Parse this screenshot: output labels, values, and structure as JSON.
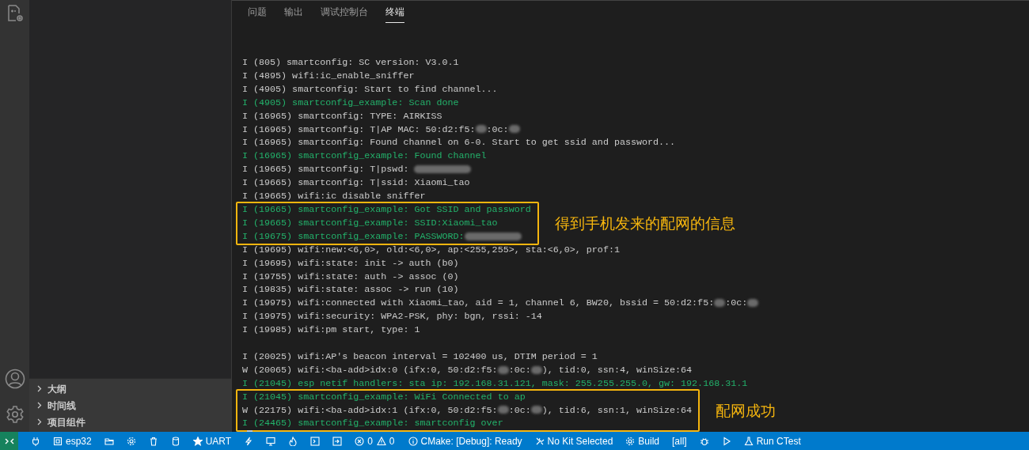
{
  "sidebar": {
    "sections": [
      {
        "label": "大纲",
        "expanded": false
      },
      {
        "label": "时间线",
        "expanded": false
      },
      {
        "label": "项目组件",
        "expanded": false
      }
    ]
  },
  "panel": {
    "tabs": [
      {
        "label": "问题",
        "selected": false
      },
      {
        "label": "输出",
        "selected": false
      },
      {
        "label": "调试控制台",
        "selected": false
      },
      {
        "label": "终端",
        "selected": true
      }
    ],
    "blocks": [
      {
        "lines": [
          {
            "green": false,
            "segments": [
              "I (805) smartconfig: SC version: V3.0.1"
            ]
          },
          {
            "green": false,
            "segments": [
              "I (4895) wifi:ic_enable_sniffer"
            ]
          },
          {
            "green": false,
            "segments": [
              "I (4905) smartconfig: Start to find channel..."
            ]
          },
          {
            "green": true,
            "segments": [
              "I (4905) smartconfig_example: Scan done"
            ]
          },
          {
            "green": false,
            "segments": [
              "I (16965) smartconfig: TYPE: AIRKISS"
            ]
          },
          {
            "green": false,
            "segments": [
              "I (16965) smartconfig: T|AP MAC: 50:d2:f5:",
              {
                "kind": "blur"
              },
              ":0c:",
              {
                "kind": "blur"
              }
            ]
          },
          {
            "green": false,
            "segments": [
              "I (16965) smartconfig: Found channel on 6-0. Start to get ssid and password..."
            ]
          },
          {
            "green": true,
            "segments": [
              "I (16965) smartconfig_example: Found channel"
            ]
          },
          {
            "green": false,
            "segments": [
              "I (19665) smartconfig: T|pswd: ",
              {
                "kind": "mask"
              }
            ]
          },
          {
            "green": false,
            "segments": [
              "I (19665) smartconfig: T|ssid: Xiaomi_tao"
            ]
          },
          {
            "green": false,
            "segments": [
              "I (19665) wifi:ic disable sniffer"
            ]
          }
        ]
      },
      {
        "annotation": "得到手机发来的配网的信息",
        "lines": [
          {
            "green": true,
            "segments": [
              "I (19665) smartconfig_example: Got SSID and password"
            ]
          },
          {
            "green": true,
            "segments": [
              "I (19665) smartconfig_example: SSID:Xiaomi_tao"
            ]
          },
          {
            "green": true,
            "segments": [
              "I (19675) smartconfig_example: PASSWORD:",
              {
                "kind": "mask"
              }
            ]
          }
        ]
      },
      {
        "lines": [
          {
            "green": false,
            "segments": [
              "I (19695) wifi:new:<6,0>, old:<6,0>, ap:<255,255>, sta:<6,0>, prof:1"
            ]
          },
          {
            "green": false,
            "segments": [
              "I (19695) wifi:state: init -> auth (b0)"
            ]
          },
          {
            "green": false,
            "segments": [
              "I (19755) wifi:state: auth -> assoc (0)"
            ]
          },
          {
            "green": false,
            "segments": [
              "I (19835) wifi:state: assoc -> run (10)"
            ]
          },
          {
            "green": false,
            "segments": [
              "I (19975) wifi:connected with Xiaomi_tao, aid = 1, channel 6, BW20, bssid = 50:d2:f5:",
              {
                "kind": "blur"
              },
              ":0c:",
              {
                "kind": "blur"
              }
            ]
          },
          {
            "green": false,
            "segments": [
              "I (19975) wifi:security: WPA2-PSK, phy: bgn, rssi: -14"
            ]
          },
          {
            "green": false,
            "segments": [
              "I (19985) wifi:pm start, type: 1"
            ]
          },
          {
            "kind": "blank"
          },
          {
            "green": false,
            "segments": [
              "I (20025) wifi:AP's beacon interval = 102400 us, DTIM period = 1"
            ]
          },
          {
            "green": false,
            "segments": [
              "W (20065) wifi:<ba-add>idx:0 (ifx:0, 50:d2:f5:",
              {
                "kind": "blur"
              },
              ":0c:",
              {
                "kind": "blur"
              },
              "), tid:0, ssn:4, winSize:64"
            ]
          },
          {
            "green": true,
            "segments": [
              "I (21045) esp netif handlers: sta ip: 192.168.31.121, mask: 255.255.255.0, gw: 192.168.31.1"
            ]
          }
        ]
      },
      {
        "annotation": "配网成功",
        "lines": [
          {
            "green": true,
            "segments": [
              "I (21045) smartconfig_example: WiFi Connected to ap"
            ]
          },
          {
            "green": false,
            "segments": [
              "W (22175) wifi:<ba-add>idx:1 (ifx:0, 50:d2:f5:",
              {
                "kind": "blur"
              },
              ":0c:",
              {
                "kind": "blur"
              },
              "), tid:6, ssn:1, winSize:64"
            ]
          },
          {
            "green": true,
            "segments": [
              "I (24465) smartconfig_example: smartconfig over"
            ]
          }
        ]
      }
    ]
  },
  "status_bar": {
    "items": [
      {
        "kind": "plug"
      },
      {
        "kind": "board",
        "text": "esp32"
      },
      {
        "kind": "folder"
      },
      {
        "kind": "gear"
      },
      {
        "kind": "trash"
      },
      {
        "kind": "cylinder"
      },
      {
        "kind": "star",
        "text": "UART"
      },
      {
        "kind": "flash"
      },
      {
        "kind": "monitor"
      },
      {
        "kind": "flame"
      },
      {
        "kind": "terminal"
      },
      {
        "kind": "enter"
      },
      {
        "kind": "error",
        "text": "0"
      },
      {
        "kind": "warning",
        "text": "0"
      },
      {
        "kind": "info",
        "text": "CMake: [Debug]: Ready"
      },
      {
        "kind": "tools",
        "text": "No Kit Selected"
      },
      {
        "kind": "gear",
        "text": "Build"
      },
      {
        "kind": "plain",
        "text": "[all]"
      },
      {
        "kind": "bug"
      },
      {
        "kind": "play"
      },
      {
        "kind": "flask",
        "text": "Run CTest"
      }
    ]
  }
}
